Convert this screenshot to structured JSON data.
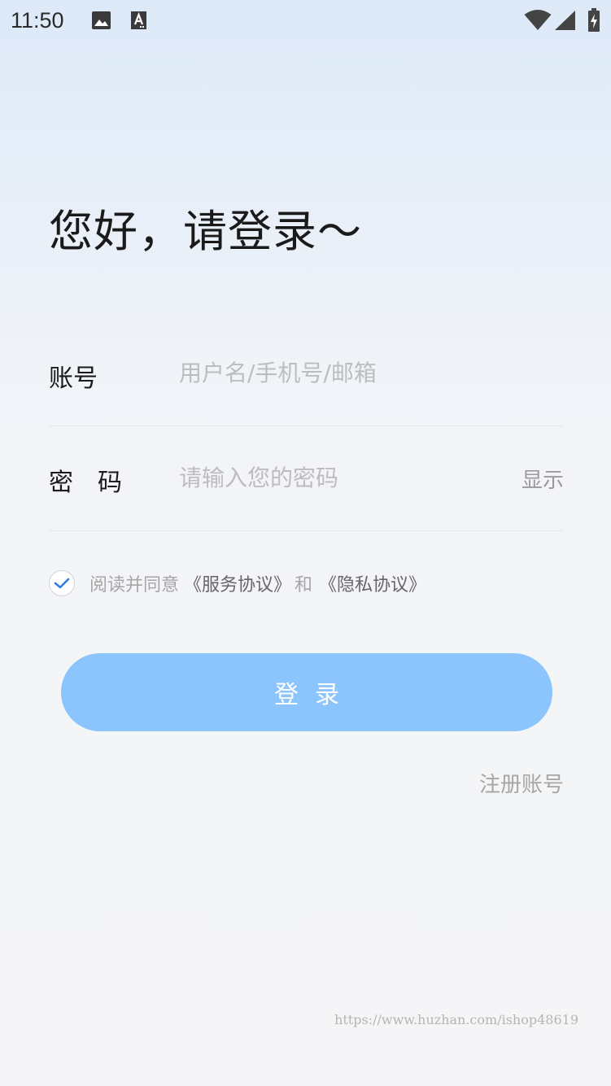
{
  "status_bar": {
    "time": "11:50",
    "icons": [
      "image-icon",
      "font-icon",
      "wifi-icon",
      "signal-icon",
      "battery-charging-icon"
    ]
  },
  "heading": "您好，请登录～",
  "account": {
    "label": "账号",
    "placeholder": "用户名/手机号/邮箱"
  },
  "password": {
    "label": "密　码",
    "placeholder": "请输入您的密码",
    "show_label": "显示"
  },
  "agreement": {
    "checked": true,
    "prefix": "阅读并同意",
    "service_link": "《服务协议》",
    "and": "和",
    "privacy_link": "《隐私协议》"
  },
  "login_button": "登录",
  "register_link": "注册账号",
  "watermark": "https://www.huzhan.com/ishop48619",
  "colors": {
    "button": "#8cc4fd",
    "check": "#2f7ee0",
    "placeholder": "#bdbdbd"
  }
}
